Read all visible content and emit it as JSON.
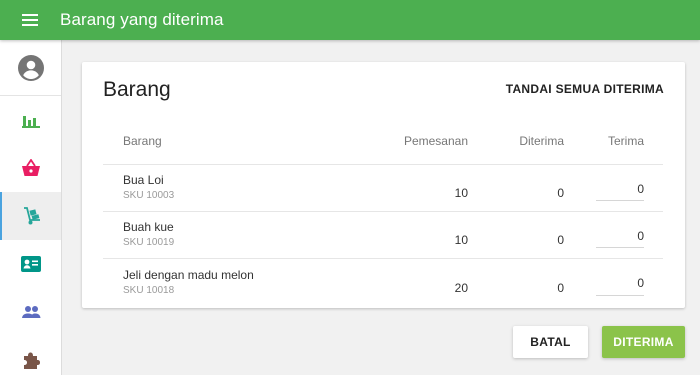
{
  "header": {
    "title": "Barang yang diterima",
    "menu_icon": "hamburger-menu-icon",
    "color": "#4caf50"
  },
  "sidebar": {
    "avatar_icon": "account-circle-icon",
    "items": [
      {
        "icon": "bar-chart-icon",
        "color": "#4caf50",
        "active": false
      },
      {
        "icon": "shopping-basket-icon",
        "color": "#e91e63",
        "active": false
      },
      {
        "icon": "hand-truck-icon",
        "color": "#26a69a",
        "active": true
      },
      {
        "icon": "contact-card-icon",
        "color": "#009688",
        "active": false
      },
      {
        "icon": "people-icon",
        "color": "#5c6bc0",
        "active": false
      },
      {
        "icon": "puzzle-piece-icon",
        "color": "#795548",
        "active": false
      }
    ]
  },
  "card": {
    "title": "Barang",
    "mark_all_label": "TANDAI SEMUA DITERIMA"
  },
  "table": {
    "headers": {
      "item": "Barang",
      "ordered": "Pemesanan",
      "received": "Diterima",
      "receive": "Terima"
    },
    "rows": [
      {
        "name": "Bua Loi",
        "sku": "SKU 10003",
        "ordered": "10",
        "received": "0",
        "receive": "0"
      },
      {
        "name": "Buah kue",
        "sku": "SKU 10019",
        "ordered": "10",
        "received": "0",
        "receive": "0"
      },
      {
        "name": "Jeli dengan madu melon",
        "sku": "SKU 10018",
        "ordered": "20",
        "received": "0",
        "receive": "0"
      }
    ]
  },
  "actions": {
    "cancel_label": "BATAL",
    "confirm_label": "DITERIMA",
    "confirm_color": "#8bc34a"
  }
}
